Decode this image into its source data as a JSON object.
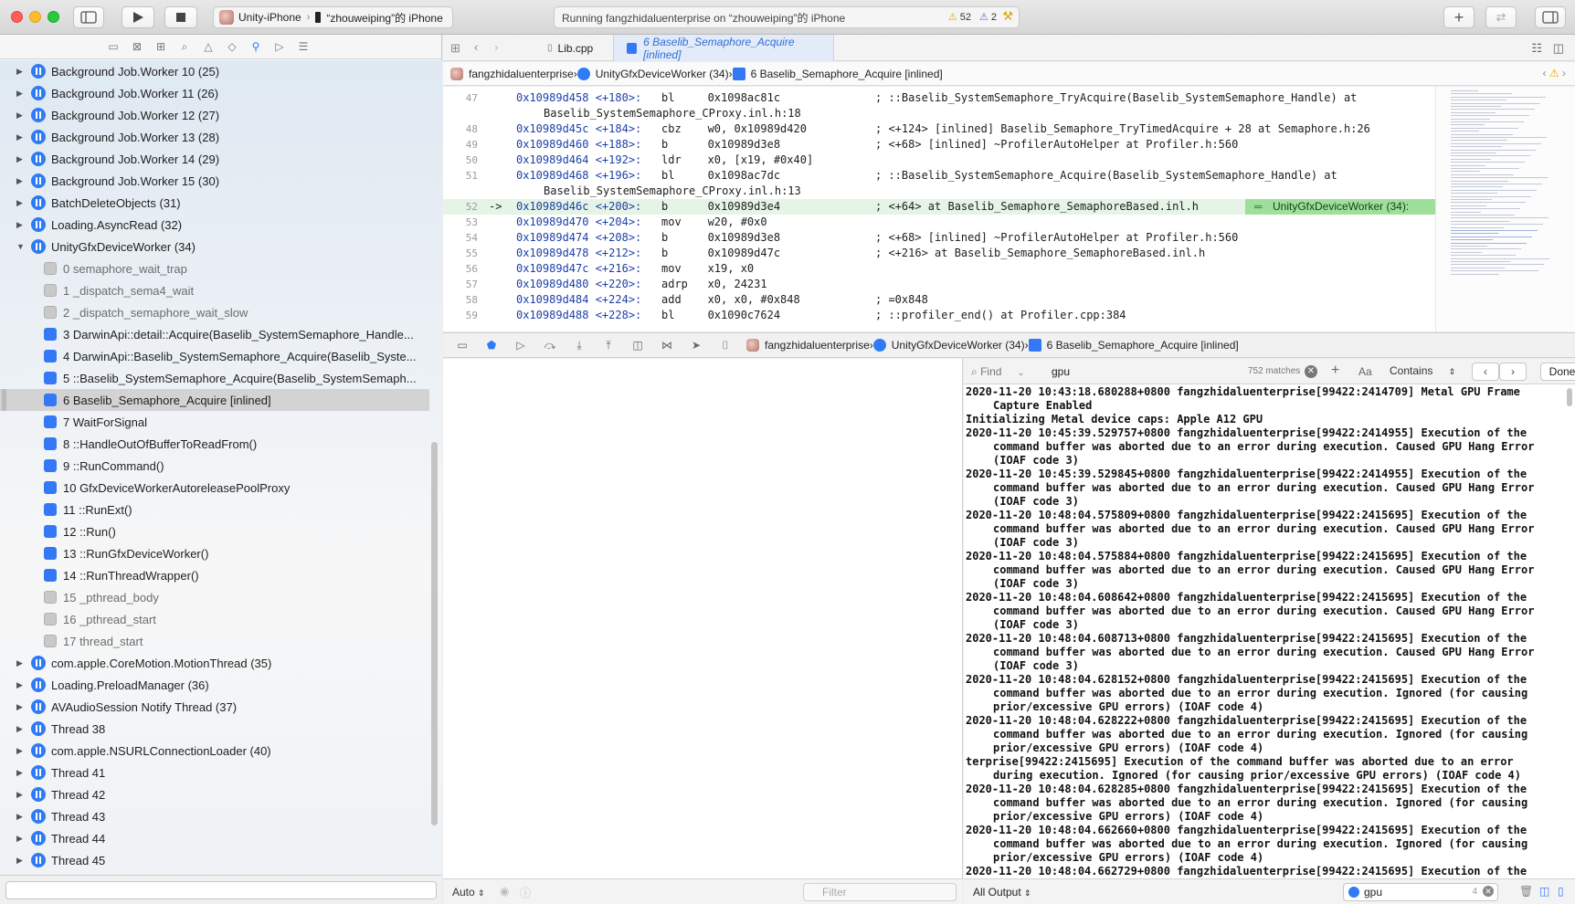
{
  "toolbar": {
    "scheme_app": "Unity-iPhone",
    "scheme_device": "“zhouweiping”的 iPhone",
    "status_text": "Running fangzhidaluenterprise on “zhouweiping”的 iPhone",
    "warning_count": "52",
    "error_count": "2"
  },
  "threads_top": [
    {
      "label": "Background Job.Worker 10 (25)"
    },
    {
      "label": "Background Job.Worker 11 (26)"
    },
    {
      "label": "Background Job.Worker 12 (27)"
    },
    {
      "label": "Background Job.Worker 13 (28)"
    },
    {
      "label": "Background Job.Worker 14 (29)"
    },
    {
      "label": "Background Job.Worker 15 (30)"
    },
    {
      "label": "BatchDeleteObjects (31)"
    },
    {
      "label": "Loading.AsyncRead (32)"
    }
  ],
  "expanded_thread": {
    "label": "UnityGfxDeviceWorker (34)"
  },
  "frames": [
    {
      "label": "0 semaphore_wait_trap",
      "kind": "sys"
    },
    {
      "label": "1 _dispatch_sema4_wait",
      "kind": "sys"
    },
    {
      "label": "2 _dispatch_semaphore_wait_slow",
      "kind": "sys"
    },
    {
      "label": "3 DarwinApi::detail::Acquire(Baselib_SystemSemaphore_Handle...",
      "kind": "usr"
    },
    {
      "label": "4 DarwinApi::Baselib_SystemSemaphore_Acquire(Baselib_Syste...",
      "kind": "usr"
    },
    {
      "label": "5 ::Baselib_SystemSemaphore_Acquire(Baselib_SystemSemaph...",
      "kind": "usr"
    },
    {
      "label": "6 Baselib_Semaphore_Acquire [inlined]",
      "kind": "usr",
      "selected": true
    },
    {
      "label": "7 WaitForSignal",
      "kind": "usr"
    },
    {
      "label": "8 ::HandleOutOfBufferToReadFrom()",
      "kind": "usr"
    },
    {
      "label": "9 ::RunCommand()",
      "kind": "usr"
    },
    {
      "label": "10 GfxDeviceWorkerAutoreleasePoolProxy",
      "kind": "usr"
    },
    {
      "label": "11 ::RunExt()",
      "kind": "usr"
    },
    {
      "label": "12 ::Run()",
      "kind": "usr"
    },
    {
      "label": "13 ::RunGfxDeviceWorker()",
      "kind": "usr"
    },
    {
      "label": "14 ::RunThreadWrapper()",
      "kind": "usr"
    },
    {
      "label": "15 _pthread_body",
      "kind": "sys"
    },
    {
      "label": "16 _pthread_start",
      "kind": "sys"
    },
    {
      "label": "17 thread_start",
      "kind": "sys"
    }
  ],
  "threads_bottom": [
    {
      "label": "com.apple.CoreMotion.MotionThread (35)"
    },
    {
      "label": "Loading.PreloadManager (36)"
    },
    {
      "label": "AVAudioSession Notify Thread (37)"
    },
    {
      "label": "Thread 38"
    },
    {
      "label": "com.apple.NSURLConnectionLoader (40)"
    },
    {
      "label": "Thread 41"
    },
    {
      "label": "Thread 42"
    },
    {
      "label": "Thread 43"
    },
    {
      "label": "Thread 44"
    },
    {
      "label": "Thread 45"
    }
  ],
  "editor": {
    "tab_file": "Lib.cpp",
    "tab_active": "6 Baselib_Semaphore_Acquire [inlined]",
    "crumbs": [
      "fangzhidaluenterprise",
      "UnityGfxDeviceWorker (34)",
      "6 Baselib_Semaphore_Acquire [inlined]"
    ],
    "thread_badge": "UnityGfxDeviceWorker (34):"
  },
  "code_lines": [
    {
      "ln": "47",
      "arrow": "",
      "addr": "0x10989d458 <+180>:",
      "ins": "bl     0x1098ac81c",
      "cmt": "; ::Baselib_SystemSemaphore_TryAcquire(Baselib_SystemSemaphore_Handle) at"
    },
    {
      "ln": "",
      "arrow": "",
      "addr": "",
      "ins": "",
      "cmt": "Baselib_SystemSemaphore_CProxy.inl.h:18",
      "cont": true
    },
    {
      "ln": "48",
      "arrow": "",
      "addr": "0x10989d45c <+184>:",
      "ins": "cbz    w0, 0x10989d420",
      "cmt": "; <+124> [inlined] Baselib_Semaphore_TryTimedAcquire + 28 at Semaphore.h:26"
    },
    {
      "ln": "49",
      "arrow": "",
      "addr": "0x10989d460 <+188>:",
      "ins": "b      0x10989d3e8",
      "cmt": "; <+68> [inlined] ~ProfilerAutoHelper at Profiler.h:560"
    },
    {
      "ln": "50",
      "arrow": "",
      "addr": "0x10989d464 <+192>:",
      "ins": "ldr    x0, [x19, #0x40]",
      "cmt": ""
    },
    {
      "ln": "51",
      "arrow": "",
      "addr": "0x10989d468 <+196>:",
      "ins": "bl     0x1098ac7dc",
      "cmt": "; ::Baselib_SystemSemaphore_Acquire(Baselib_SystemSemaphore_Handle) at"
    },
    {
      "ln": "",
      "arrow": "",
      "addr": "",
      "ins": "",
      "cmt": "Baselib_SystemSemaphore_CProxy.inl.h:13",
      "cont": true
    },
    {
      "ln": "52",
      "arrow": "->",
      "addr": "0x10989d46c <+200>:",
      "ins": "b      0x10989d3e4",
      "cmt": "; <+64> at Baselib_Semaphore_SemaphoreBased.inl.h",
      "hl": true
    },
    {
      "ln": "53",
      "arrow": "",
      "addr": "0x10989d470 <+204>:",
      "ins": "mov    w20, #0x0",
      "cmt": ""
    },
    {
      "ln": "54",
      "arrow": "",
      "addr": "0x10989d474 <+208>:",
      "ins": "b      0x10989d3e8",
      "cmt": "; <+68> [inlined] ~ProfilerAutoHelper at Profiler.h:560"
    },
    {
      "ln": "55",
      "arrow": "",
      "addr": "0x10989d478 <+212>:",
      "ins": "b      0x10989d47c",
      "cmt": "; <+216> at Baselib_Semaphore_SemaphoreBased.inl.h"
    },
    {
      "ln": "56",
      "arrow": "",
      "addr": "0x10989d47c <+216>:",
      "ins": "mov    x19, x0",
      "cmt": ""
    },
    {
      "ln": "57",
      "arrow": "",
      "addr": "0x10989d480 <+220>:",
      "ins": "adrp   x0, 24231",
      "cmt": ""
    },
    {
      "ln": "58",
      "arrow": "",
      "addr": "0x10989d484 <+224>:",
      "ins": "add    x0, x0, #0x848",
      "cmt": "; =0x848"
    },
    {
      "ln": "59",
      "arrow": "",
      "addr": "0x10989d488 <+228>:",
      "ins": "bl     0x1090c7624",
      "cmt": "; ::profiler_end() at Profiler.cpp:384"
    }
  ],
  "debugbar": {
    "crumbs": [
      "fangzhidaluenterprise",
      "UnityGfxDeviceWorker (34)",
      "6 Baselib_Semaphore_Acquire [inlined]"
    ]
  },
  "vars": {
    "scope": "Auto",
    "filter_placeholder": "Filter"
  },
  "find": {
    "label": "Find",
    "query": "gpu",
    "matches": "752 matches",
    "mode": "Contains",
    "done": "Done"
  },
  "log": [
    "2020-11-20 10:43:18.680288+0800 fangzhidaluenterprise[99422:2414709] Metal GPU Frame Capture Enabled",
    "Initializing Metal device caps: Apple A12 GPU",
    "2020-11-20 10:45:39.529757+0800 fangzhidaluenterprise[99422:2414955] Execution of the command buffer was aborted due to an error during execution. Caused GPU Hang Error (IOAF code 3)",
    "2020-11-20 10:45:39.529845+0800 fangzhidaluenterprise[99422:2414955] Execution of the command buffer was aborted due to an error during execution. Caused GPU Hang Error (IOAF code 3)",
    "2020-11-20 10:48:04.575809+0800 fangzhidaluenterprise[99422:2415695] Execution of the command buffer was aborted due to an error during execution. Caused GPU Hang Error (IOAF code 3)",
    "2020-11-20 10:48:04.575884+0800 fangzhidaluenterprise[99422:2415695] Execution of the command buffer was aborted due to an error during execution. Caused GPU Hang Error (IOAF code 3)",
    "2020-11-20 10:48:04.608642+0800 fangzhidaluenterprise[99422:2415695] Execution of the command buffer was aborted due to an error during execution. Caused GPU Hang Error (IOAF code 3)",
    "2020-11-20 10:48:04.608713+0800 fangzhidaluenterprise[99422:2415695] Execution of the command buffer was aborted due to an error during execution. Caused GPU Hang Error (IOAF code 3)",
    "2020-11-20 10:48:04.628152+0800 fangzhidaluenterprise[99422:2415695] Execution of the command buffer was aborted due to an error during execution. Ignored (for causing prior/excessive GPU errors) (IOAF code 4)",
    "2020-11-20 10:48:04.628222+0800 fangzhidaluenterprise[99422:2415695] Execution of the command buffer was aborted due to an error during execution. Ignored (for causing prior/excessive GPU errors) (IOAF code 4)",
    "terprise[99422:2415695] Execution of the command buffer was aborted due to an error during execution. Ignored (for causing prior/excessive GPU errors) (IOAF code 4)",
    "2020-11-20 10:48:04.628285+0800 fangzhidaluenterprise[99422:2415695] Execution of the command buffer was aborted due to an error during execution. Ignored (for causing prior/excessive GPU errors) (IOAF code 4)",
    "2020-11-20 10:48:04.662660+0800 fangzhidaluenterprise[99422:2415695] Execution of the command buffer was aborted due to an error during execution. Ignored (for causing prior/excessive GPU errors) (IOAF code 4)",
    "2020-11-20 10:48:04.662729+0800 fangzhidaluenterprise[99422:2415695] Execution of the"
  ],
  "console_footer": {
    "output": "All Output",
    "filter": "gpu",
    "count": "4"
  }
}
